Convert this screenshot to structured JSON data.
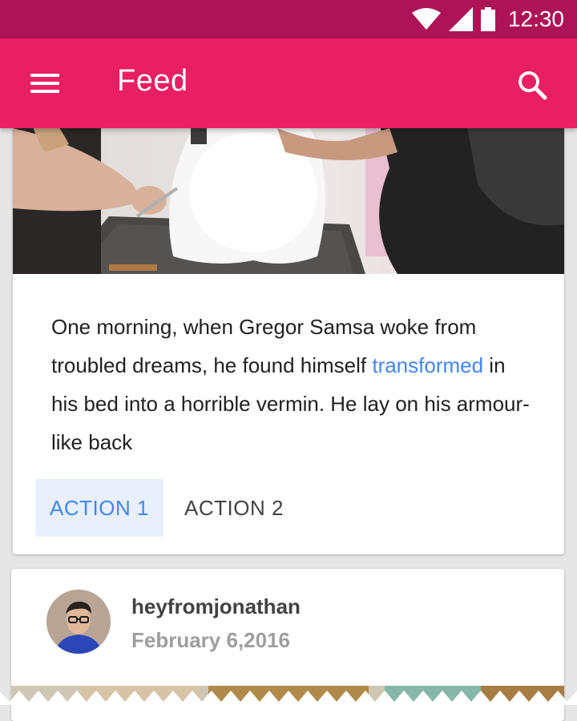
{
  "status_bar": {
    "time": "12:30",
    "icons": [
      "wifi-icon",
      "signal-icon",
      "battery-icon"
    ]
  },
  "app_bar": {
    "title": "Feed",
    "menu_icon": "menu-icon",
    "search_icon": "search-icon"
  },
  "card": {
    "text_before": "One morning, when Gregor Samsa woke from troubled dreams, he found himself ",
    "link_text": "transformed",
    "text_after": " in his bed into a horrible vermin. He lay on his armour-like back",
    "actions": {
      "primary": "ACTION 1",
      "secondary": "ACTION 2"
    }
  },
  "post": {
    "username": "heyfromjonathan",
    "date": "February 6,2016"
  },
  "colors": {
    "status_bar": "#ad1457",
    "app_bar": "#e91e63",
    "link": "#4285f4",
    "primary_button_bg": "#e8f0fe"
  }
}
